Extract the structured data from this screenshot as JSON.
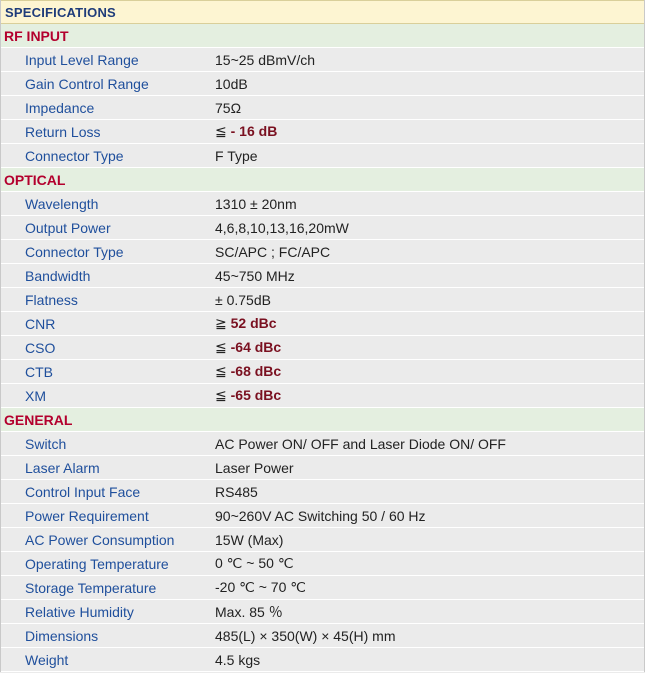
{
  "title": "SPECIFICATIONS",
  "sections": [
    {
      "name": "RF INPUT",
      "rows": [
        {
          "label": "Input Level Range",
          "value": "15~25 dBmV/ch"
        },
        {
          "label": "Gain Control Range",
          "value": "10dB"
        },
        {
          "label": "Impedance",
          "value": "75Ω"
        },
        {
          "label": "Return Loss",
          "prefix": "≦",
          "bold": " - 16 dB"
        },
        {
          "label": "Connector Type",
          "value": "F Type"
        }
      ]
    },
    {
      "name": "OPTICAL",
      "rows": [
        {
          "label": "Wavelength",
          "value": "1310 ± 20nm"
        },
        {
          "label": "Output Power",
          "value": "4,6,8,10,13,16,20mW"
        },
        {
          "label": "Connector Type",
          "value": "SC/APC ; FC/APC"
        },
        {
          "label": "Bandwidth",
          "value": "45~750 MHz"
        },
        {
          "label": "Flatness",
          "value": "± 0.75dB"
        },
        {
          "label": "CNR",
          "prefix": "≧",
          "bold": " 52 dBc"
        },
        {
          "label": "CSO",
          "prefix": "≦",
          "bold": " -64 dBc"
        },
        {
          "label": "CTB",
          "prefix": "≦",
          "bold": " -68 dBc"
        },
        {
          "label": "XM",
          "prefix": "≦",
          "bold": " -65 dBc"
        }
      ]
    },
    {
      "name": "GENERAL",
      "rows": [
        {
          "label": "Switch",
          "value": "AC Power ON/ OFF and Laser Diode ON/ OFF"
        },
        {
          "label": "Laser Alarm",
          "value": "Laser Power"
        },
        {
          "label": "Control Input Face",
          "value": "RS485"
        },
        {
          "label": "Power Requirement",
          "value": "90~260V AC Switching 50 / 60 Hz"
        },
        {
          "label": "AC Power Consumption",
          "value": "15W (Max)"
        },
        {
          "label": "Operating Temperature",
          "value": "0 ℃ ~ 50 ℃"
        },
        {
          "label": "Storage Temperature",
          "value": "-20 ℃ ~ 70 ℃"
        },
        {
          "label": "Relative Humidity",
          "value": "Max. 85 ％"
        },
        {
          "label": "Dimensions",
          "value": "485(L) × 350(W) × 45(H) mm"
        },
        {
          "label": "Weight",
          "value": "4.5 kgs"
        }
      ]
    }
  ]
}
